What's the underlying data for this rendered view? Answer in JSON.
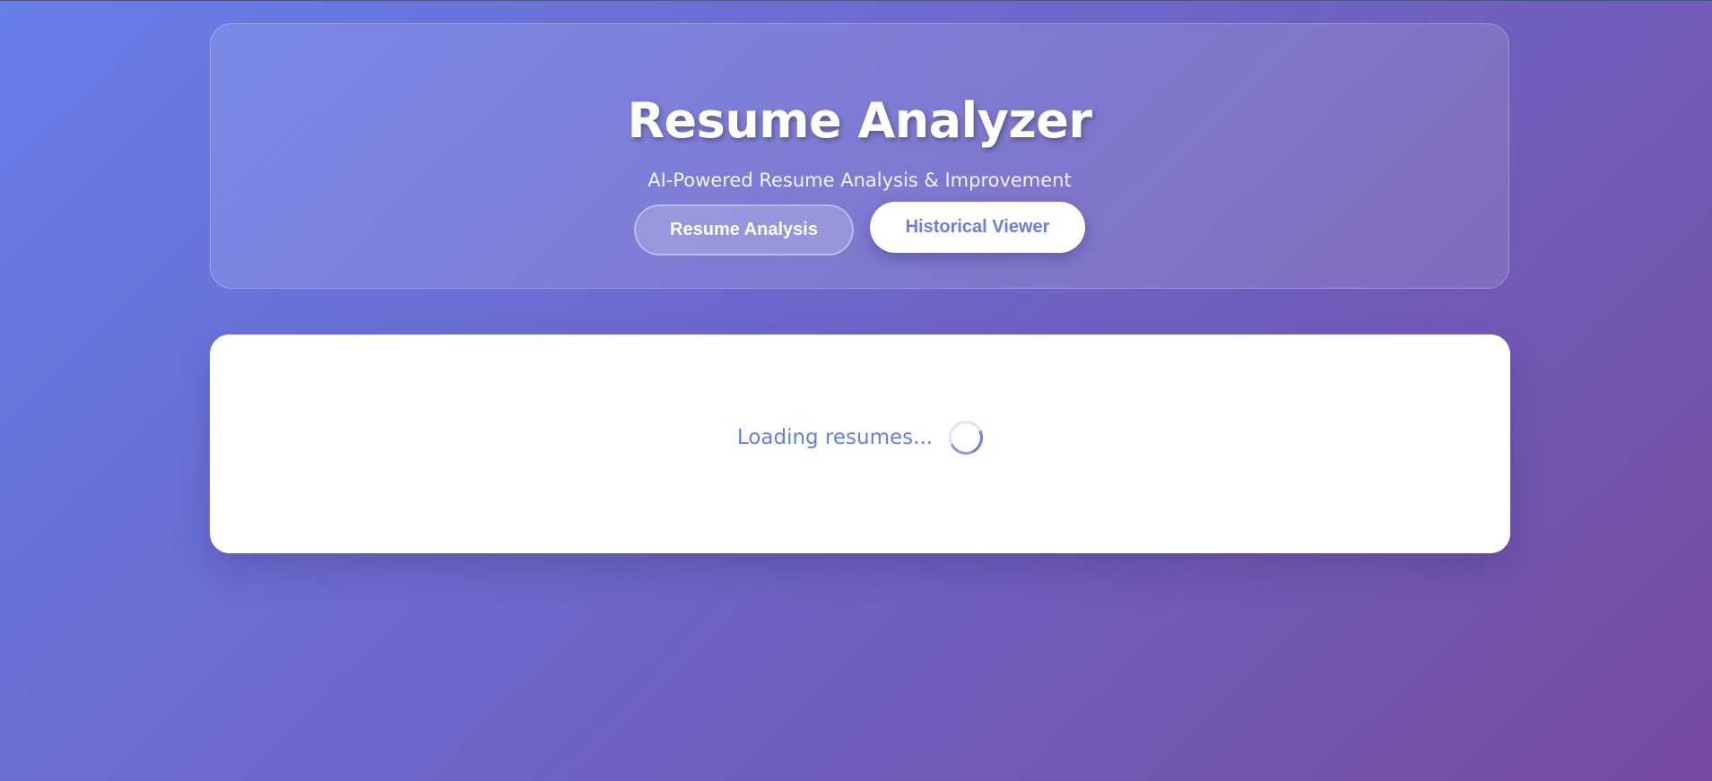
{
  "header": {
    "title": "Resume Analyzer",
    "subtitle": "AI-Powered Resume Analysis & Improvement"
  },
  "nav": {
    "resume_analysis_label": "Resume Analysis",
    "historical_viewer_label": "Historical Viewer",
    "active": "Historical Viewer"
  },
  "main": {
    "loading_text": "Loading resumes...",
    "spinner_icon": "loading-spinner-icon"
  },
  "colors": {
    "gradient_start": "#667eea",
    "gradient_end": "#764ba2",
    "accent": "#667eea",
    "card_background": "#ffffff"
  }
}
